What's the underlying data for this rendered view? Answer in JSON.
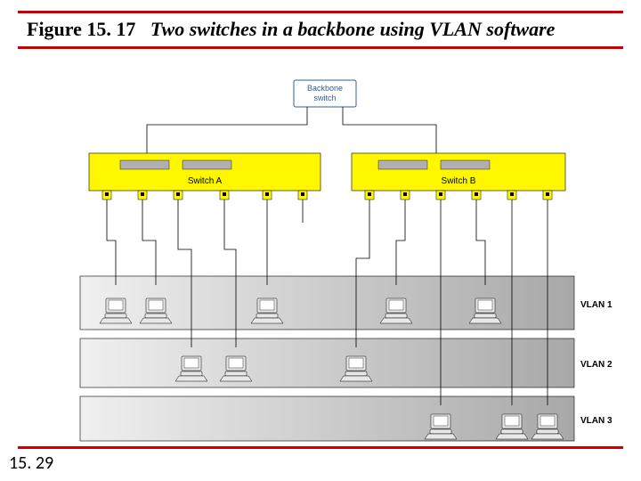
{
  "figure": {
    "number": "Figure 15. 17",
    "caption": "Two switches in a backbone using VLAN software"
  },
  "page_number": "15. 29",
  "backbone": {
    "label1": "Backbone",
    "label2": "switch"
  },
  "switches": {
    "a": {
      "label": "Switch A"
    },
    "b": {
      "label": "Switch B"
    }
  },
  "vlans": [
    {
      "label": "VLAN 1"
    },
    {
      "label": "VLAN 2"
    },
    {
      "label": "VLAN 3"
    }
  ]
}
